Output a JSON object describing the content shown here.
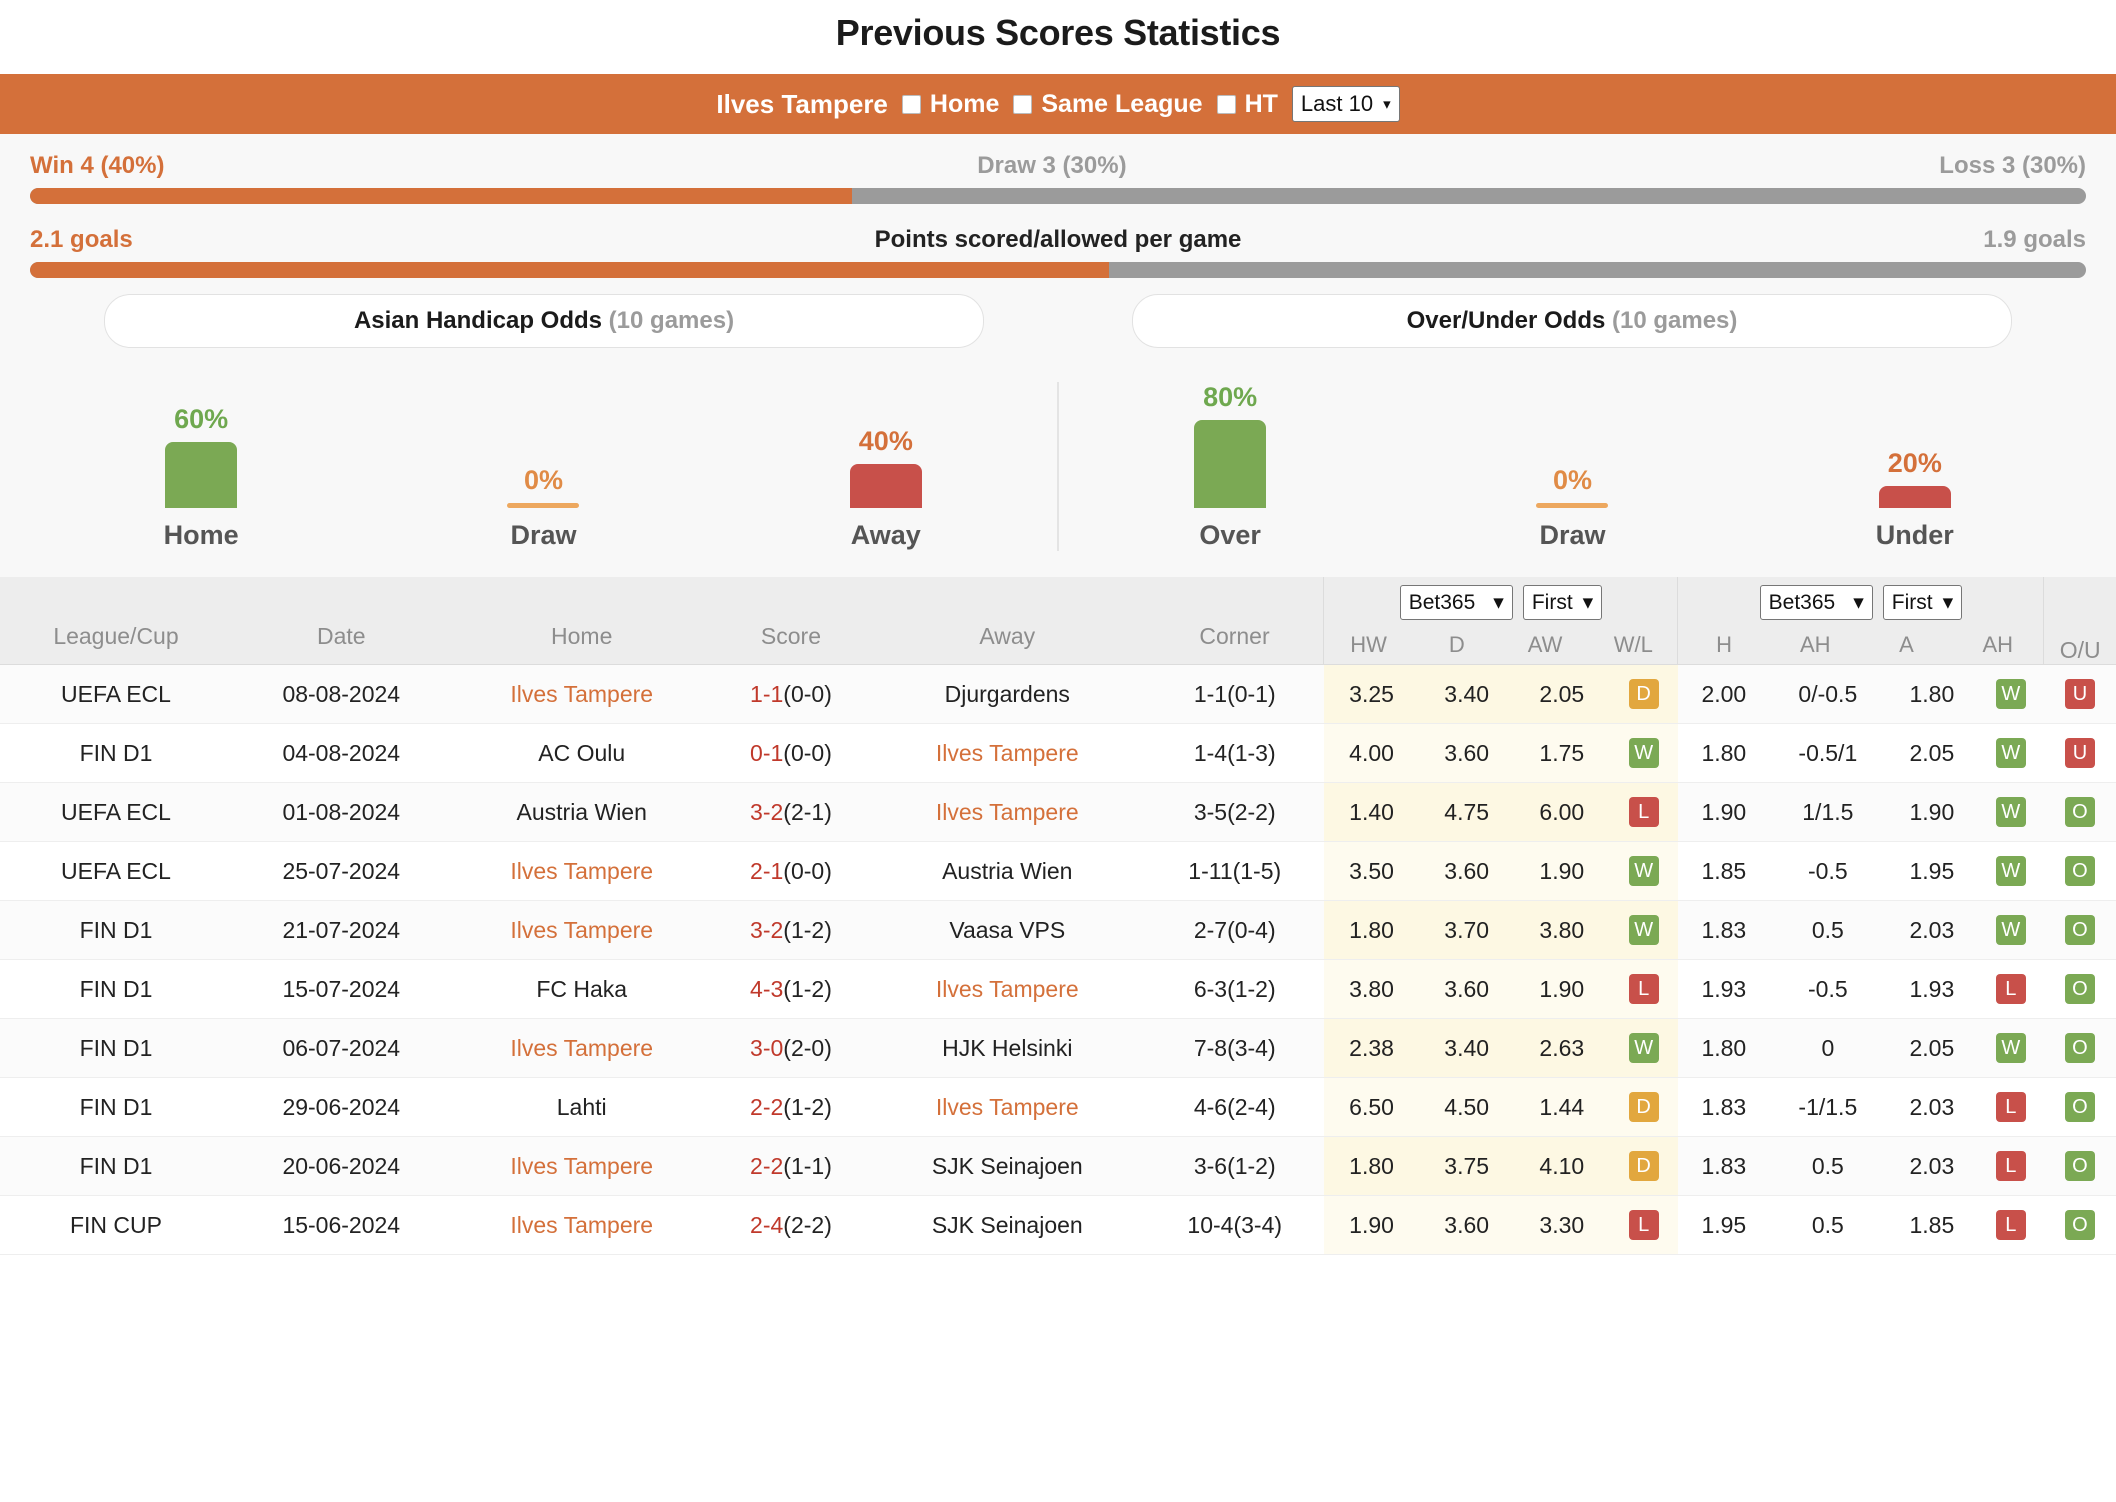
{
  "page_title": "Previous Scores Statistics",
  "team_bar": {
    "team_name": "Ilves Tampere",
    "filters": [
      {
        "label": "Home",
        "checked": false
      },
      {
        "label": "Same League",
        "checked": false
      },
      {
        "label": "HT",
        "checked": false
      }
    ],
    "range_select": {
      "value": "Last 10",
      "caret": "⌄"
    }
  },
  "summary": {
    "win_label": "Win 4 (40%)",
    "draw_label": "Draw 3 (30%)",
    "loss_label": "Loss 3 (30%)",
    "win_pct": 40,
    "goals_left": "2.1 goals",
    "goals_center": "Points scored/allowed per game",
    "goals_right": "1.9 goals",
    "goals_left_pct": 52.5
  },
  "odds_tabs": {
    "left_title": "Asian Handicap Odds",
    "left_games": "(10 games)",
    "right_title": "Over/Under Odds",
    "right_games": "(10 games)"
  },
  "chart_data": [
    {
      "type": "bar",
      "title": "Asian Handicap Odds (10 games)",
      "categories": [
        "Home",
        "Draw",
        "Away"
      ],
      "values": [
        60,
        0,
        40
      ],
      "labels": [
        "60%",
        "0%",
        "40%"
      ],
      "colors": [
        "#7ba954",
        "#eda85f",
        "#c8504a"
      ],
      "label_colors": [
        "#6fa84f",
        "#e08b46",
        "#d4703a"
      ],
      "ylabel": "",
      "xlabel": "",
      "ylim": [
        0,
        100
      ],
      "grid": false,
      "legend": "none"
    },
    {
      "type": "bar",
      "title": "Over/Under Odds (10 games)",
      "categories": [
        "Over",
        "Draw",
        "Under"
      ],
      "values": [
        80,
        0,
        20
      ],
      "labels": [
        "80%",
        "0%",
        "20%"
      ],
      "colors": [
        "#7ba954",
        "#eda85f",
        "#c8504a"
      ],
      "label_colors": [
        "#6fa84f",
        "#e08b46",
        "#d4703a"
      ],
      "ylabel": "",
      "xlabel": "",
      "ylim": [
        0,
        100
      ],
      "grid": false,
      "legend": "none"
    }
  ],
  "table": {
    "headers": [
      "League/Cup",
      "Date",
      "Home",
      "Score",
      "Away",
      "Corner"
    ],
    "group1": {
      "bookmaker": "Bet365",
      "period": "First",
      "subheaders": [
        "HW",
        "D",
        "AW",
        "W/L"
      ]
    },
    "group2": {
      "bookmaker": "Bet365",
      "period": "First",
      "subheaders": [
        "H",
        "AH",
        "A",
        "AH"
      ]
    },
    "ou_header": "O/U",
    "rows": [
      {
        "league": "UEFA ECL",
        "date": "08-08-2024",
        "home": "Ilves Tampere",
        "home_hl": true,
        "score_main": "1-1",
        "score_sub": "(0-0)",
        "away": "Djurgardens",
        "away_hl": false,
        "corner": "1-1(0-1)",
        "hw": "3.25",
        "d": "3.40",
        "aw": "2.05",
        "wl": "D",
        "h": "2.00",
        "ah1": "0/-0.5",
        "a": "1.80",
        "ah2": "W",
        "ou": "U"
      },
      {
        "league": "FIN D1",
        "date": "04-08-2024",
        "home": "AC Oulu",
        "home_hl": false,
        "score_main": "0-1",
        "score_sub": "(0-0)",
        "away": "Ilves Tampere",
        "away_hl": true,
        "corner": "1-4(1-3)",
        "hw": "4.00",
        "d": "3.60",
        "aw": "1.75",
        "wl": "W",
        "h": "1.80",
        "ah1": "-0.5/1",
        "a": "2.05",
        "ah2": "W",
        "ou": "U"
      },
      {
        "league": "UEFA ECL",
        "date": "01-08-2024",
        "home": "Austria Wien",
        "home_hl": false,
        "score_main": "3-2",
        "score_sub": "(2-1)",
        "away": "Ilves Tampere",
        "away_hl": true,
        "corner": "3-5(2-2)",
        "hw": "1.40",
        "d": "4.75",
        "aw": "6.00",
        "wl": "L",
        "h": "1.90",
        "ah1": "1/1.5",
        "a": "1.90",
        "ah2": "W",
        "ou": "O"
      },
      {
        "league": "UEFA ECL",
        "date": "25-07-2024",
        "home": "Ilves Tampere",
        "home_hl": true,
        "score_main": "2-1",
        "score_sub": "(0-0)",
        "away": "Austria Wien",
        "away_hl": false,
        "corner": "1-11(1-5)",
        "hw": "3.50",
        "d": "3.60",
        "aw": "1.90",
        "wl": "W",
        "h": "1.85",
        "ah1": "-0.5",
        "a": "1.95",
        "ah2": "W",
        "ou": "O"
      },
      {
        "league": "FIN D1",
        "date": "21-07-2024",
        "home": "Ilves Tampere",
        "home_hl": true,
        "score_main": "3-2",
        "score_sub": "(1-2)",
        "away": "Vaasa VPS",
        "away_hl": false,
        "corner": "2-7(0-4)",
        "hw": "1.80",
        "d": "3.70",
        "aw": "3.80",
        "wl": "W",
        "h": "1.83",
        "ah1": "0.5",
        "a": "2.03",
        "ah2": "W",
        "ou": "O"
      },
      {
        "league": "FIN D1",
        "date": "15-07-2024",
        "home": "FC Haka",
        "home_hl": false,
        "score_main": "4-3",
        "score_sub": "(1-2)",
        "away": "Ilves Tampere",
        "away_hl": true,
        "corner": "6-3(1-2)",
        "hw": "3.80",
        "d": "3.60",
        "aw": "1.90",
        "wl": "L",
        "h": "1.93",
        "ah1": "-0.5",
        "a": "1.93",
        "ah2": "L",
        "ou": "O"
      },
      {
        "league": "FIN D1",
        "date": "06-07-2024",
        "home": "Ilves Tampere",
        "home_hl": true,
        "score_main": "3-0",
        "score_sub": "(2-0)",
        "away": "HJK Helsinki",
        "away_hl": false,
        "corner": "7-8(3-4)",
        "hw": "2.38",
        "d": "3.40",
        "aw": "2.63",
        "wl": "W",
        "h": "1.80",
        "ah1": "0",
        "a": "2.05",
        "ah2": "W",
        "ou": "O"
      },
      {
        "league": "FIN D1",
        "date": "29-06-2024",
        "home": "Lahti",
        "home_hl": false,
        "score_main": "2-2",
        "score_sub": "(1-2)",
        "away": "Ilves Tampere",
        "away_hl": true,
        "corner": "4-6(2-4)",
        "hw": "6.50",
        "d": "4.50",
        "aw": "1.44",
        "wl": "D",
        "h": "1.83",
        "ah1": "-1/1.5",
        "a": "2.03",
        "ah2": "L",
        "ou": "O"
      },
      {
        "league": "FIN D1",
        "date": "20-06-2024",
        "home": "Ilves Tampere",
        "home_hl": true,
        "score_main": "2-2",
        "score_sub": "(1-1)",
        "away": "SJK Seinajoen",
        "away_hl": false,
        "corner": "3-6(1-2)",
        "hw": "1.80",
        "d": "3.75",
        "aw": "4.10",
        "wl": "D",
        "h": "1.83",
        "ah1": "0.5",
        "a": "2.03",
        "ah2": "L",
        "ou": "O"
      },
      {
        "league": "FIN CUP",
        "date": "15-06-2024",
        "home": "Ilves Tampere",
        "home_hl": true,
        "score_main": "2-4",
        "score_sub": "(2-2)",
        "away": "SJK Seinajoen",
        "away_hl": false,
        "corner": "10-4(3-4)",
        "hw": "1.90",
        "d": "3.60",
        "aw": "3.30",
        "wl": "L",
        "h": "1.95",
        "ah1": "0.5",
        "a": "1.85",
        "ah2": "L",
        "ou": "O"
      }
    ]
  }
}
